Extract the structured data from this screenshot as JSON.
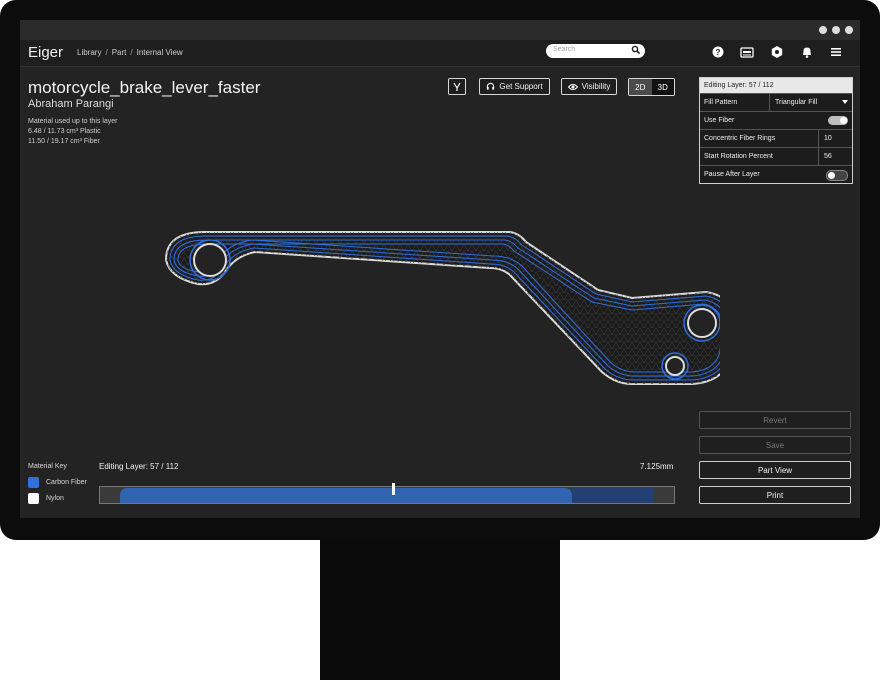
{
  "app": {
    "brand": "Eiger",
    "breadcrumb": [
      "Library",
      "Part",
      "Internal View"
    ],
    "breadcrumb_sep": "/",
    "search_placeholder": "Search"
  },
  "toolbar_icons": [
    "help-icon",
    "printer-icon",
    "settings-hex-icon",
    "bell-icon",
    "menu-icon"
  ],
  "part": {
    "name": "motorcycle_brake_lever_faster",
    "owner": "Abraham Parangi",
    "material_heading": "Material used up to this layer",
    "plastic_usage": "6.48 / 11.73 cm³ Plastic",
    "fiber_usage": "11.50 / 19.17 cm³ Fiber"
  },
  "actions": {
    "support_label": "Get Support",
    "visibility_label": "Visibility",
    "view_2d": "2D",
    "view_3d": "3D",
    "active_view": "2D"
  },
  "layer_panel": {
    "header": "Editing Layer: 57 / 112",
    "fill_pattern_label": "Fill Pattern",
    "fill_pattern_value": "Triangular Fill",
    "use_fiber_label": "Use Fiber",
    "use_fiber_on": true,
    "fiber_rings_label": "Concentric Fiber Rings",
    "fiber_rings_value": "10",
    "rotation_label": "Start Rotation Percent",
    "rotation_value": "56",
    "pause_label": "Pause After Layer",
    "pause_on": false
  },
  "side_buttons": {
    "revert": "Revert",
    "save": "Save",
    "part_view": "Part View",
    "print": "Print"
  },
  "material_key": {
    "title": "Material Key",
    "items": [
      {
        "label": "Carbon Fiber",
        "color": "#2f6fe0"
      },
      {
        "label": "Nylon",
        "color": "#ffffff"
      }
    ]
  },
  "layer_slider": {
    "label": "Editing Layer: 57 / 112",
    "height_label": "7.125mm",
    "current_layer": 57,
    "total_layers": 112
  },
  "colors": {
    "accent": "#2f6fe0",
    "background": "#232323"
  }
}
